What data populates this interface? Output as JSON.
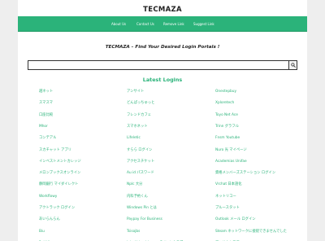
{
  "site": {
    "title": "TECMAZA"
  },
  "nav": [
    {
      "name": "nav-about-us",
      "label": "About Us"
    },
    {
      "name": "nav-contact-us",
      "label": "Contact Us"
    },
    {
      "name": "nav-remove-link",
      "label": "Remove Link"
    },
    {
      "name": "nav-suggest-link",
      "label": "Suggest Link"
    }
  ],
  "tagline": "TECMAZA – Find Your Desired Login Portals !",
  "search": {
    "placeholder": "",
    "icon": "search-icon"
  },
  "latest": {
    "title": "Latest Logins",
    "rows": [
      [
        "越ネット",
        "アンサイト",
        "Onestepbuy"
      ],
      [
        "スマスマ",
        "どんぱっちゅっと",
        "Xploretech"
      ],
      [
        "口座比較",
        "フレンドカフェ",
        "Toyo Net Ace"
      ],
      [
        "Mhor",
        "スマホネット",
        "Trinn グラフル"
      ],
      [
        "コンテアル",
        "Lifeletic",
        "Fnsm Youtube"
      ],
      [
        "スカチャット アプリ",
        "すらら ログイン",
        "Nuro 光 マイページ"
      ],
      [
        "インベストメントカレッジ",
        "アクセスチケット",
        "Academias Unifae"
      ],
      [
        "メロンブックスオンライン",
        "Au id パスワード",
        "資格メンバーズステーション ログイン"
      ],
      [
        "静岡銀行 マイダイレクト",
        "Nplc 大分",
        "Vrchat 日本語化"
      ],
      [
        "Workflowy",
        "内科予約くん",
        "ネットリコー"
      ],
      [
        "アクトラック ログイン",
        "Windows Pin とは",
        "プルースタット"
      ],
      [
        "あいらんらん",
        "Paypay For Business",
        "Outlook メール ログイン"
      ],
      [
        "Biu",
        "Tsisojbs",
        "Steam ネットワークに接続できませんでした"
      ],
      [
        "Pr-kitline",
        "Job+Yahoo! Japan ポイントクラブ",
        "アンドウトフロー"
      ]
    ]
  },
  "colors": {
    "accent": "#2bb37a",
    "background": "#eeeeee",
    "panel": "#ffffff"
  }
}
